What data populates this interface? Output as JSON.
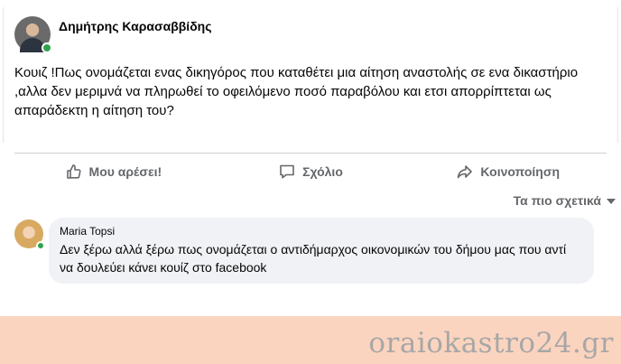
{
  "post": {
    "author": "Δημήτρης Καρασαββίδης",
    "text": "Κουιζ  !Πως ονομάζεται ενας δικηγόρος που καταθέτει μια αίτηση αναστολής σε ενα δικαστήριο ,αλλα δεν μεριμνά να πληρωθεί το οφειλόμενο ποσό παραβόλου και ετσι απορρίπτεται ως απαράδεκτη η αίτηση του?"
  },
  "actions": {
    "like": "Μου αρέσει!",
    "comment": "Σχόλιο",
    "share": "Κοινοποίηση"
  },
  "sort": {
    "label": "Τα πιο σχετικά"
  },
  "comment": {
    "name": "Maria Topsi",
    "text": "Δεν ξέρω αλλά ξέρω πως ονομάζεται ο αντιδήμαρχος οικονομικών του δήμου μας που αντί να δουλεύει κάνει κουίζ στο facebook"
  },
  "watermark": "oraiokastro24.gr",
  "colors": {
    "online": "#31a24c",
    "action_text": "#65676b",
    "bubble": "#f0f2f5",
    "footer": "#fbd4bf"
  }
}
